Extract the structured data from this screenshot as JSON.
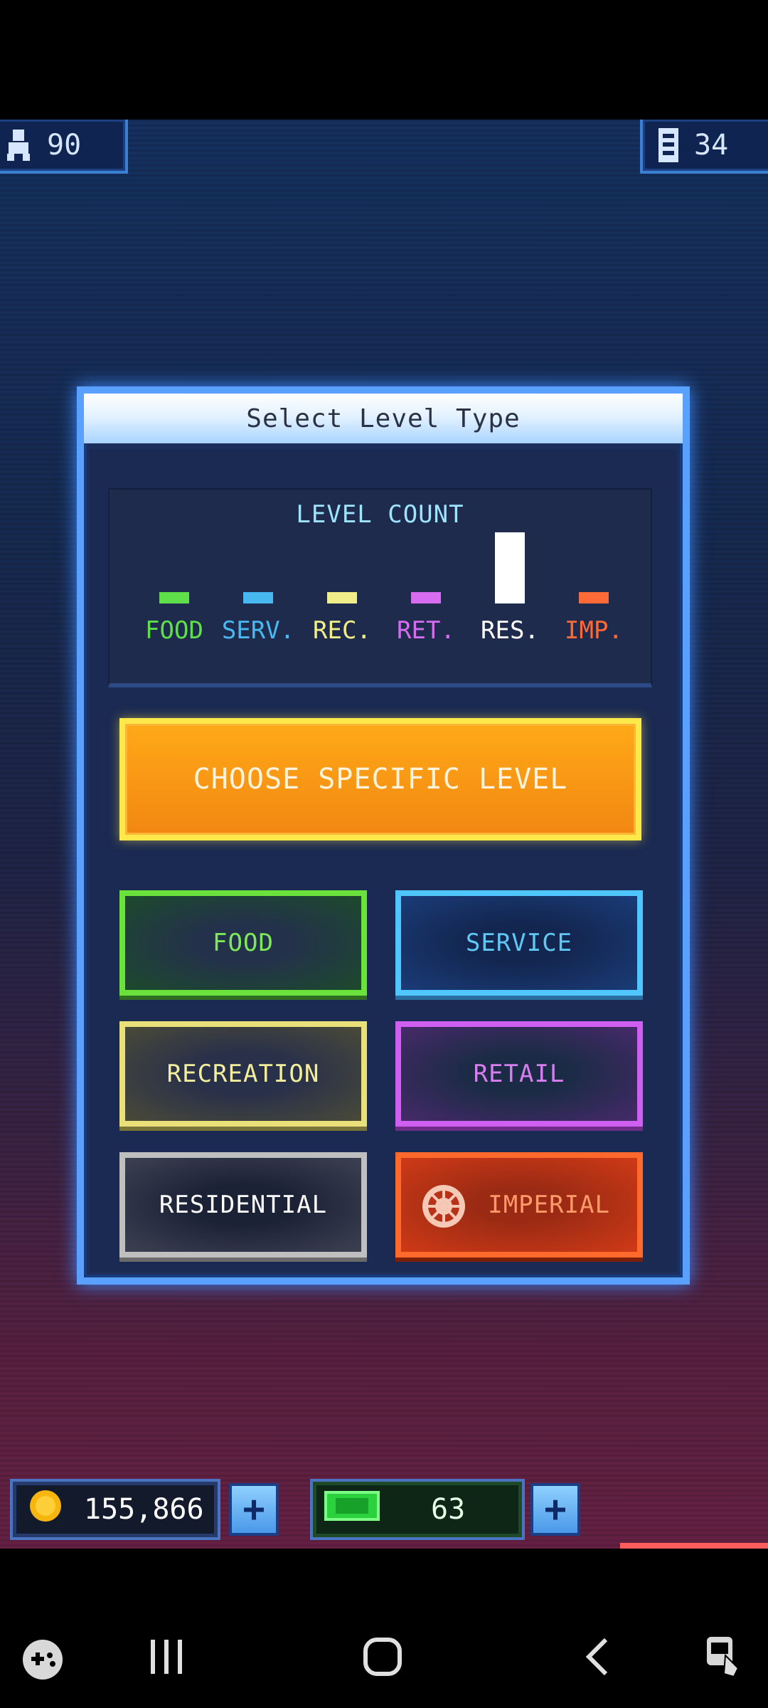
{
  "top_stats": {
    "population": "90",
    "floors": "34"
  },
  "dialog": {
    "title": "Select Level Type",
    "level_count": {
      "title": "LEVEL COUNT",
      "categories": [
        {
          "label": "FOOD",
          "color": "#5fe04a",
          "level": 0.1
        },
        {
          "label": "SERV.",
          "color": "#47b9f0",
          "level": 0.1
        },
        {
          "label": "REC.",
          "color": "#f1ee8a",
          "level": 0.15
        },
        {
          "label": "RET.",
          "color": "#d66cf0",
          "level": 0.08
        },
        {
          "label": "RES.",
          "color": "#ffffff",
          "level": 1.0
        },
        {
          "label": "IMP.",
          "color": "#ff6a36",
          "level": 0.1
        }
      ]
    },
    "choose_specific": "CHOOSE SPECIFIC LEVEL",
    "buttons": {
      "food": "FOOD",
      "service": "SERVICE",
      "recreation": "RECREATION",
      "retail": "RETAIL",
      "residential": "RESIDENTIAL",
      "imperial": "IMPERIAL"
    }
  },
  "hud": {
    "coins": "155,866",
    "bux": "63"
  },
  "icons": {
    "population": "person-icon",
    "floors": "building-icon",
    "coin": "coin-icon",
    "bux": "bux-icon",
    "close": "close-icon"
  }
}
